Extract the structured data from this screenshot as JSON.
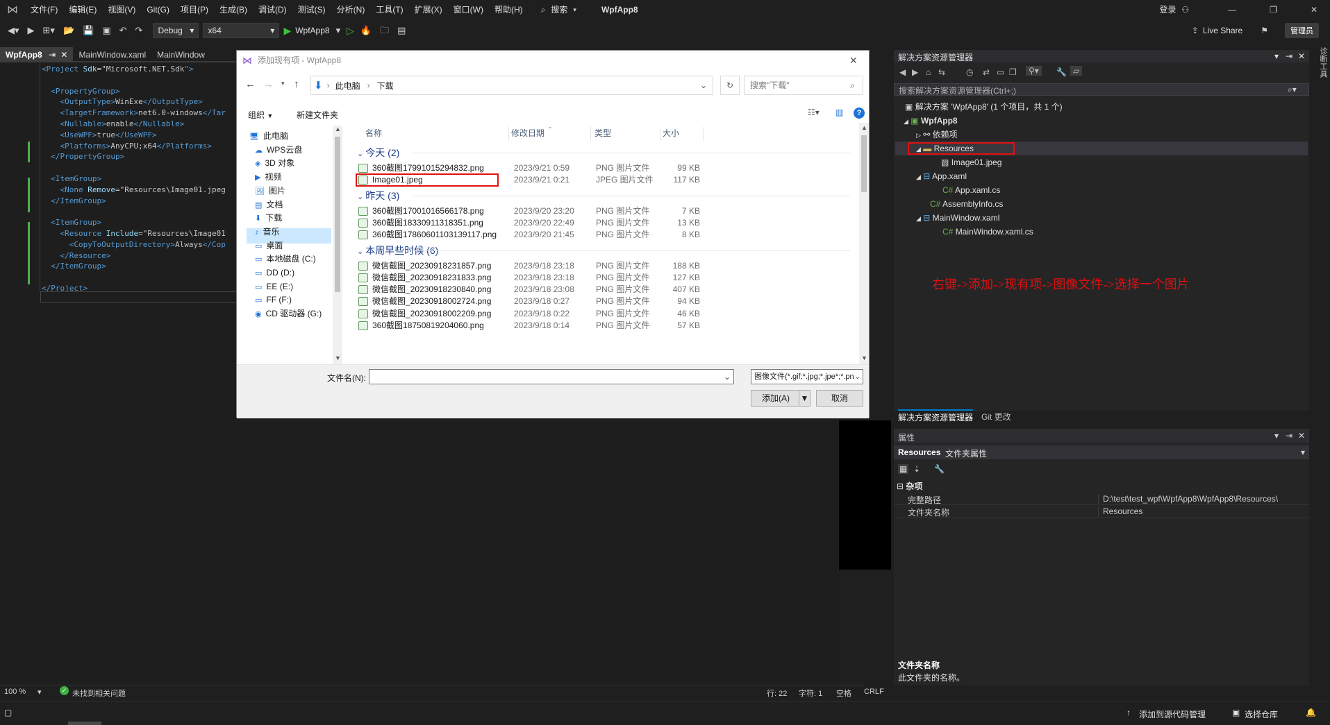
{
  "menu": [
    "文件(F)",
    "编辑(E)",
    "视图(V)",
    "Git(G)",
    "项目(P)",
    "生成(B)",
    "调试(D)",
    "测试(S)",
    "分析(N)",
    "工具(T)",
    "扩展(X)",
    "窗口(W)",
    "帮助(H)"
  ],
  "search_label": "搜索",
  "project_name": "WpfApp8",
  "login_label": "登录",
  "live_share": "Live Share",
  "admin_badge": "管理员",
  "toolbar": {
    "config": "Debug",
    "platform": "x64",
    "run_target": "WpfApp8"
  },
  "tabs": [
    {
      "label": "WpfApp8",
      "pin": "⇥",
      "close": "✕"
    },
    {
      "label": "MainWindow.xaml"
    },
    {
      "label": "MainWindow"
    }
  ],
  "code_lines": [
    [
      {
        "t": "<",
        "c": "tagc"
      },
      {
        "t": "Project",
        "c": "tagc"
      },
      {
        "t": " Sdk",
        "c": "attr"
      },
      {
        "t": "=\"",
        "c": "val"
      },
      {
        "t": "Microsoft.NET.Sdk",
        "c": "val"
      },
      {
        "t": "\">",
        "c": "tagc"
      }
    ],
    [],
    [
      {
        "t": "  <PropertyGroup>",
        "c": "tagc"
      }
    ],
    [
      {
        "t": "    <OutputType>",
        "c": "tagc"
      },
      {
        "t": "WinExe",
        "c": "val"
      },
      {
        "t": "</OutputType>",
        "c": "tagc"
      }
    ],
    [
      {
        "t": "    <TargetFramework>",
        "c": "tagc"
      },
      {
        "t": "net6.0-windows",
        "c": "val"
      },
      {
        "t": "</Tar",
        "c": "tagc"
      }
    ],
    [
      {
        "t": "    <Nullable>",
        "c": "tagc"
      },
      {
        "t": "enable",
        "c": "val"
      },
      {
        "t": "</Nullable>",
        "c": "tagc"
      }
    ],
    [
      {
        "t": "    <UseWPF>",
        "c": "tagc"
      },
      {
        "t": "true",
        "c": "val"
      },
      {
        "t": "</UseWPF>",
        "c": "tagc"
      }
    ],
    [
      {
        "t": "    <Platforms>",
        "c": "tagc"
      },
      {
        "t": "AnyCPU;x64",
        "c": "val"
      },
      {
        "t": "</Platforms>",
        "c": "tagc"
      }
    ],
    [
      {
        "t": "  </PropertyGroup>",
        "c": "tagc"
      }
    ],
    [],
    [
      {
        "t": "  <ItemGroup>",
        "c": "tagc"
      }
    ],
    [
      {
        "t": "    <None",
        "c": "tagc"
      },
      {
        "t": " Remove",
        "c": "attr"
      },
      {
        "t": "=\"Resources\\Image01.jpeg",
        "c": "val"
      }
    ],
    [
      {
        "t": "  </ItemGroup>",
        "c": "tagc"
      }
    ],
    [],
    [
      {
        "t": "  <ItemGroup>",
        "c": "tagc"
      }
    ],
    [
      {
        "t": "    <Resource",
        "c": "tagc"
      },
      {
        "t": " Include",
        "c": "attr"
      },
      {
        "t": "=\"Resources\\Image01",
        "c": "val"
      }
    ],
    [
      {
        "t": "      <CopyToOutputDirectory>",
        "c": "tagc"
      },
      {
        "t": "Always",
        "c": "val"
      },
      {
        "t": "</Cop",
        "c": "tagc"
      }
    ],
    [
      {
        "t": "    </Resource>",
        "c": "tagc"
      }
    ],
    [
      {
        "t": "  </ItemGroup>",
        "c": "tagc"
      }
    ],
    [],
    [
      {
        "t": "</Project>",
        "c": "tagc"
      }
    ]
  ],
  "status": {
    "zoom": "100 %",
    "issues": "未找到相关问题",
    "line": "行: 22",
    "char": "字符: 1",
    "space": "空格",
    "eol": "CRLF"
  },
  "bottom": {
    "source_control": "添加到源代码管理",
    "repo": "选择仓库"
  },
  "solution_explorer": {
    "title": "解决方案资源管理器",
    "search": "搜索解决方案资源管理器(Ctrl+;)",
    "items": [
      {
        "label": "解决方案 'WpfApp8' (1 个项目，共 1 个)",
        "bold": false
      },
      {
        "label": "WpfApp8",
        "bold": true
      },
      {
        "label": "依赖项"
      },
      {
        "label": "Resources"
      },
      {
        "label": "Image01.jpeg"
      },
      {
        "label": "App.xaml"
      },
      {
        "label": "App.xaml.cs"
      },
      {
        "label": "AssemblyInfo.cs"
      },
      {
        "label": "MainWindow.xaml"
      },
      {
        "label": "MainWindow.xaml.cs"
      }
    ],
    "bottom_tabs": [
      "解决方案资源管理器",
      "Git 更改"
    ]
  },
  "annotation": "右键->添加->现有项->图像文件->选择一个图片",
  "properties": {
    "title": "属性",
    "object": "Resources",
    "object_type": "文件夹属性",
    "category": "杂项",
    "rows": [
      {
        "name": "完整路径",
        "value": "D:\\test\\test_wpf\\WpfApp8\\WpfApp8\\Resources\\"
      },
      {
        "name": "文件夹名称",
        "value": "Resources"
      }
    ],
    "desc_title": "文件夹名称",
    "desc_text": "此文件夹的名称。"
  },
  "dialog": {
    "title": "添加现有项 - WpfApp8",
    "breadcrumb": [
      "此电脑",
      "下载"
    ],
    "search_placeholder": "搜索\"下载\"",
    "organize": "组织",
    "new_folder": "新建文件夹",
    "nav": [
      "此电脑",
      "WPS云盘",
      "3D 对象",
      "视频",
      "图片",
      "文档",
      "下载",
      "音乐",
      "桌面",
      "本地磁盘 (C:)",
      "DD (D:)",
      "EE (E:)",
      "FF (F:)",
      "CD 驱动器 (G:)"
    ],
    "columns": [
      "名称",
      "修改日期",
      "类型",
      "大小"
    ],
    "groups": [
      {
        "label": "今天 (2)",
        "files": [
          {
            "name": "360截图17991015294832.png",
            "date": "2023/9/21 0:59",
            "type": "PNG 图片文件",
            "size": "99 KB"
          },
          {
            "name": "Image01.jpeg",
            "date": "2023/9/21 0:21",
            "type": "JPEG 图片文件",
            "size": "117 KB"
          }
        ]
      },
      {
        "label": "昨天 (3)",
        "files": [
          {
            "name": "360截图17001016566178.png",
            "date": "2023/9/20 23:20",
            "type": "PNG 图片文件",
            "size": "7 KB"
          },
          {
            "name": "360截图18330911318351.png",
            "date": "2023/9/20 22:49",
            "type": "PNG 图片文件",
            "size": "13 KB"
          },
          {
            "name": "360截图17860601103139117.png",
            "date": "2023/9/20 21:45",
            "type": "PNG 图片文件",
            "size": "8 KB"
          }
        ]
      },
      {
        "label": "本周早些时候 (6)",
        "files": [
          {
            "name": "微信截图_20230918231857.png",
            "date": "2023/9/18 23:18",
            "type": "PNG 图片文件",
            "size": "188 KB"
          },
          {
            "name": "微信截图_20230918231833.png",
            "date": "2023/9/18 23:18",
            "type": "PNG 图片文件",
            "size": "127 KB"
          },
          {
            "name": "微信截图_20230918230840.png",
            "date": "2023/9/18 23:08",
            "type": "PNG 图片文件",
            "size": "407 KB"
          },
          {
            "name": "微信截图_20230918002724.png",
            "date": "2023/9/18 0:27",
            "type": "PNG 图片文件",
            "size": "94 KB"
          },
          {
            "name": "微信截图_20230918002209.png",
            "date": "2023/9/18 0:22",
            "type": "PNG 图片文件",
            "size": "46 KB"
          },
          {
            "name": "360截图18750819204060.png",
            "date": "2023/9/18 0:14",
            "type": "PNG 图片文件",
            "size": "57 KB"
          }
        ]
      }
    ],
    "filename_label": "文件名(N):",
    "filename_value": "",
    "filetype": "图像文件(*.gif;*.jpg;*.jpe*;*.pn",
    "add_button": "添加(A)",
    "cancel_button": "取消"
  },
  "colors": {
    "accent": "#007acc",
    "highlight_box": "#e01010",
    "note": "#e01010"
  }
}
